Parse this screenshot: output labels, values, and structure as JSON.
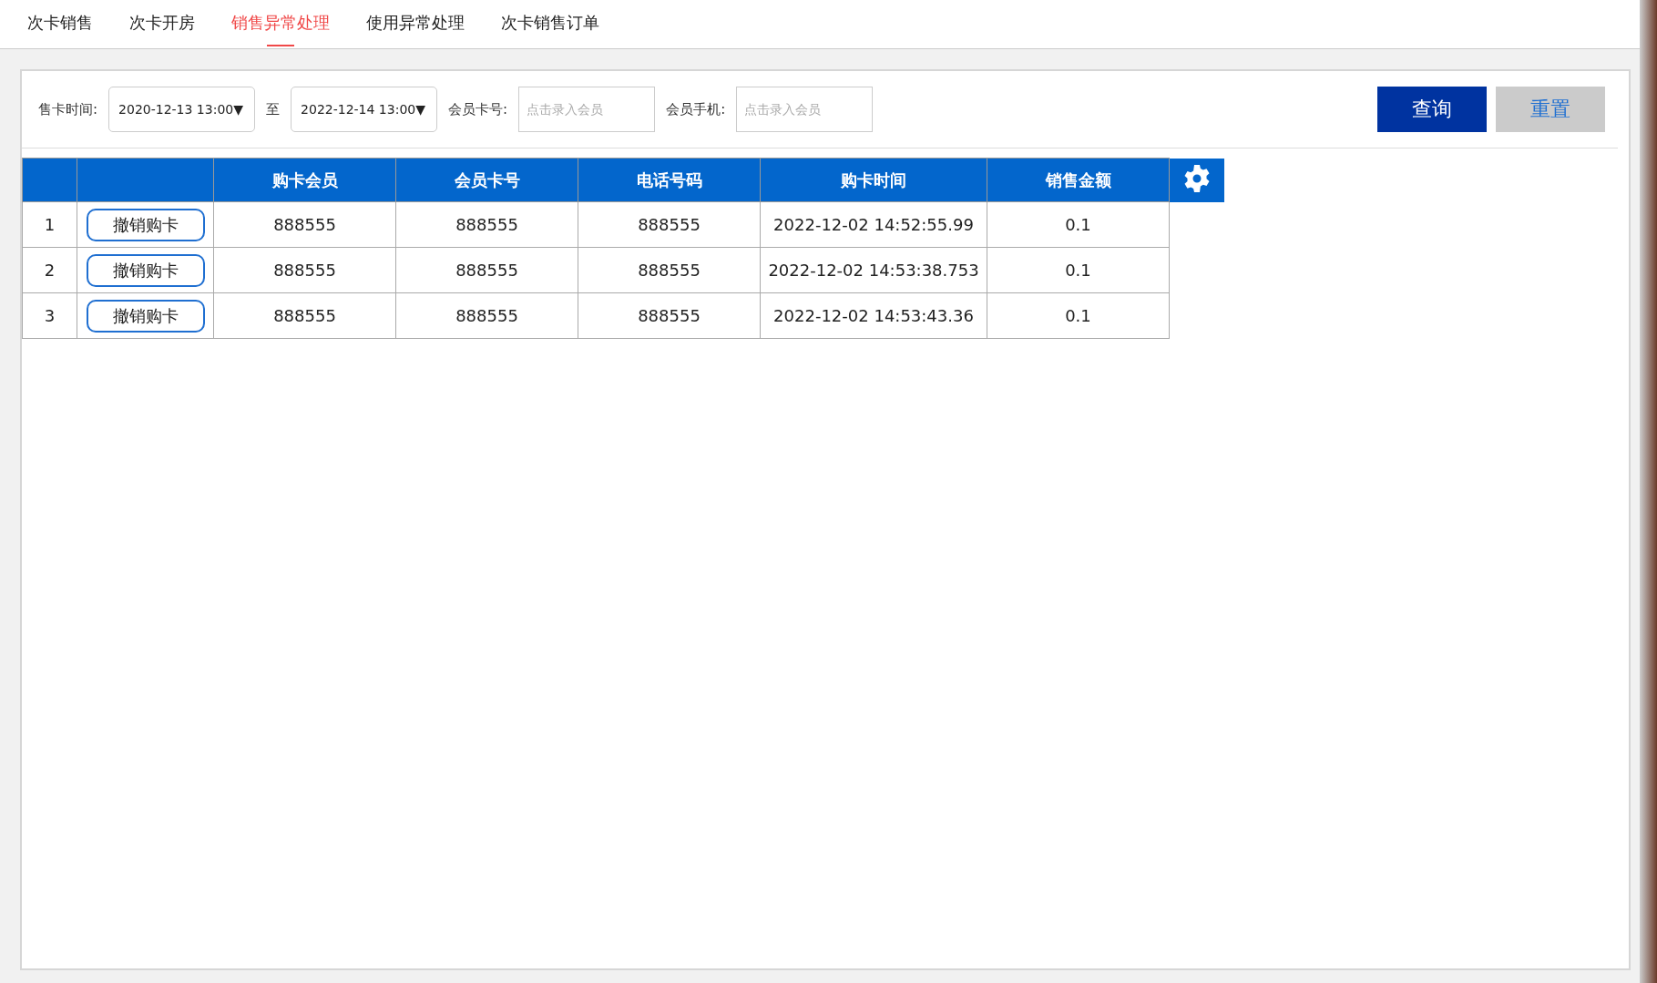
{
  "tabs": [
    {
      "label": "次卡销售",
      "selected": false
    },
    {
      "label": "次卡开房",
      "selected": false
    },
    {
      "label": "销售异常处理",
      "selected": true
    },
    {
      "label": "使用异常处理",
      "selected": false
    },
    {
      "label": "次卡销售订单",
      "selected": false
    }
  ],
  "filters": {
    "sale_time_label": "售卡时间:",
    "start": "2020-12-13 13:00",
    "dropdown_glyph": "▼",
    "to": "至",
    "end": "2022-12-14 13:00",
    "card_label": "会员卡号:",
    "card_placeholder": "点击录入会员",
    "phone_label": "会员手机:",
    "phone_placeholder": "点击录入会员"
  },
  "buttons": {
    "query": "查询",
    "reset": "重置"
  },
  "table": {
    "columns": [
      "购卡会员",
      "会员卡号",
      "电话号码",
      "购卡时间",
      "销售金额"
    ],
    "rows": [
      {
        "index": "1",
        "action": "撤销购卡",
        "cells": [
          "888555",
          "888555",
          "888555",
          "2022-12-02 14:52:55.99",
          "0.1"
        ]
      },
      {
        "index": "2",
        "action": "撤销购卡",
        "cells": [
          "888555",
          "888555",
          "888555",
          "2022-12-02 14:53:38.753",
          "0.1"
        ]
      },
      {
        "index": "3",
        "action": "撤销购卡",
        "cells": [
          "888555",
          "888555",
          "888555",
          "2022-12-02 14:53:43.36",
          "0.1"
        ]
      }
    ]
  }
}
